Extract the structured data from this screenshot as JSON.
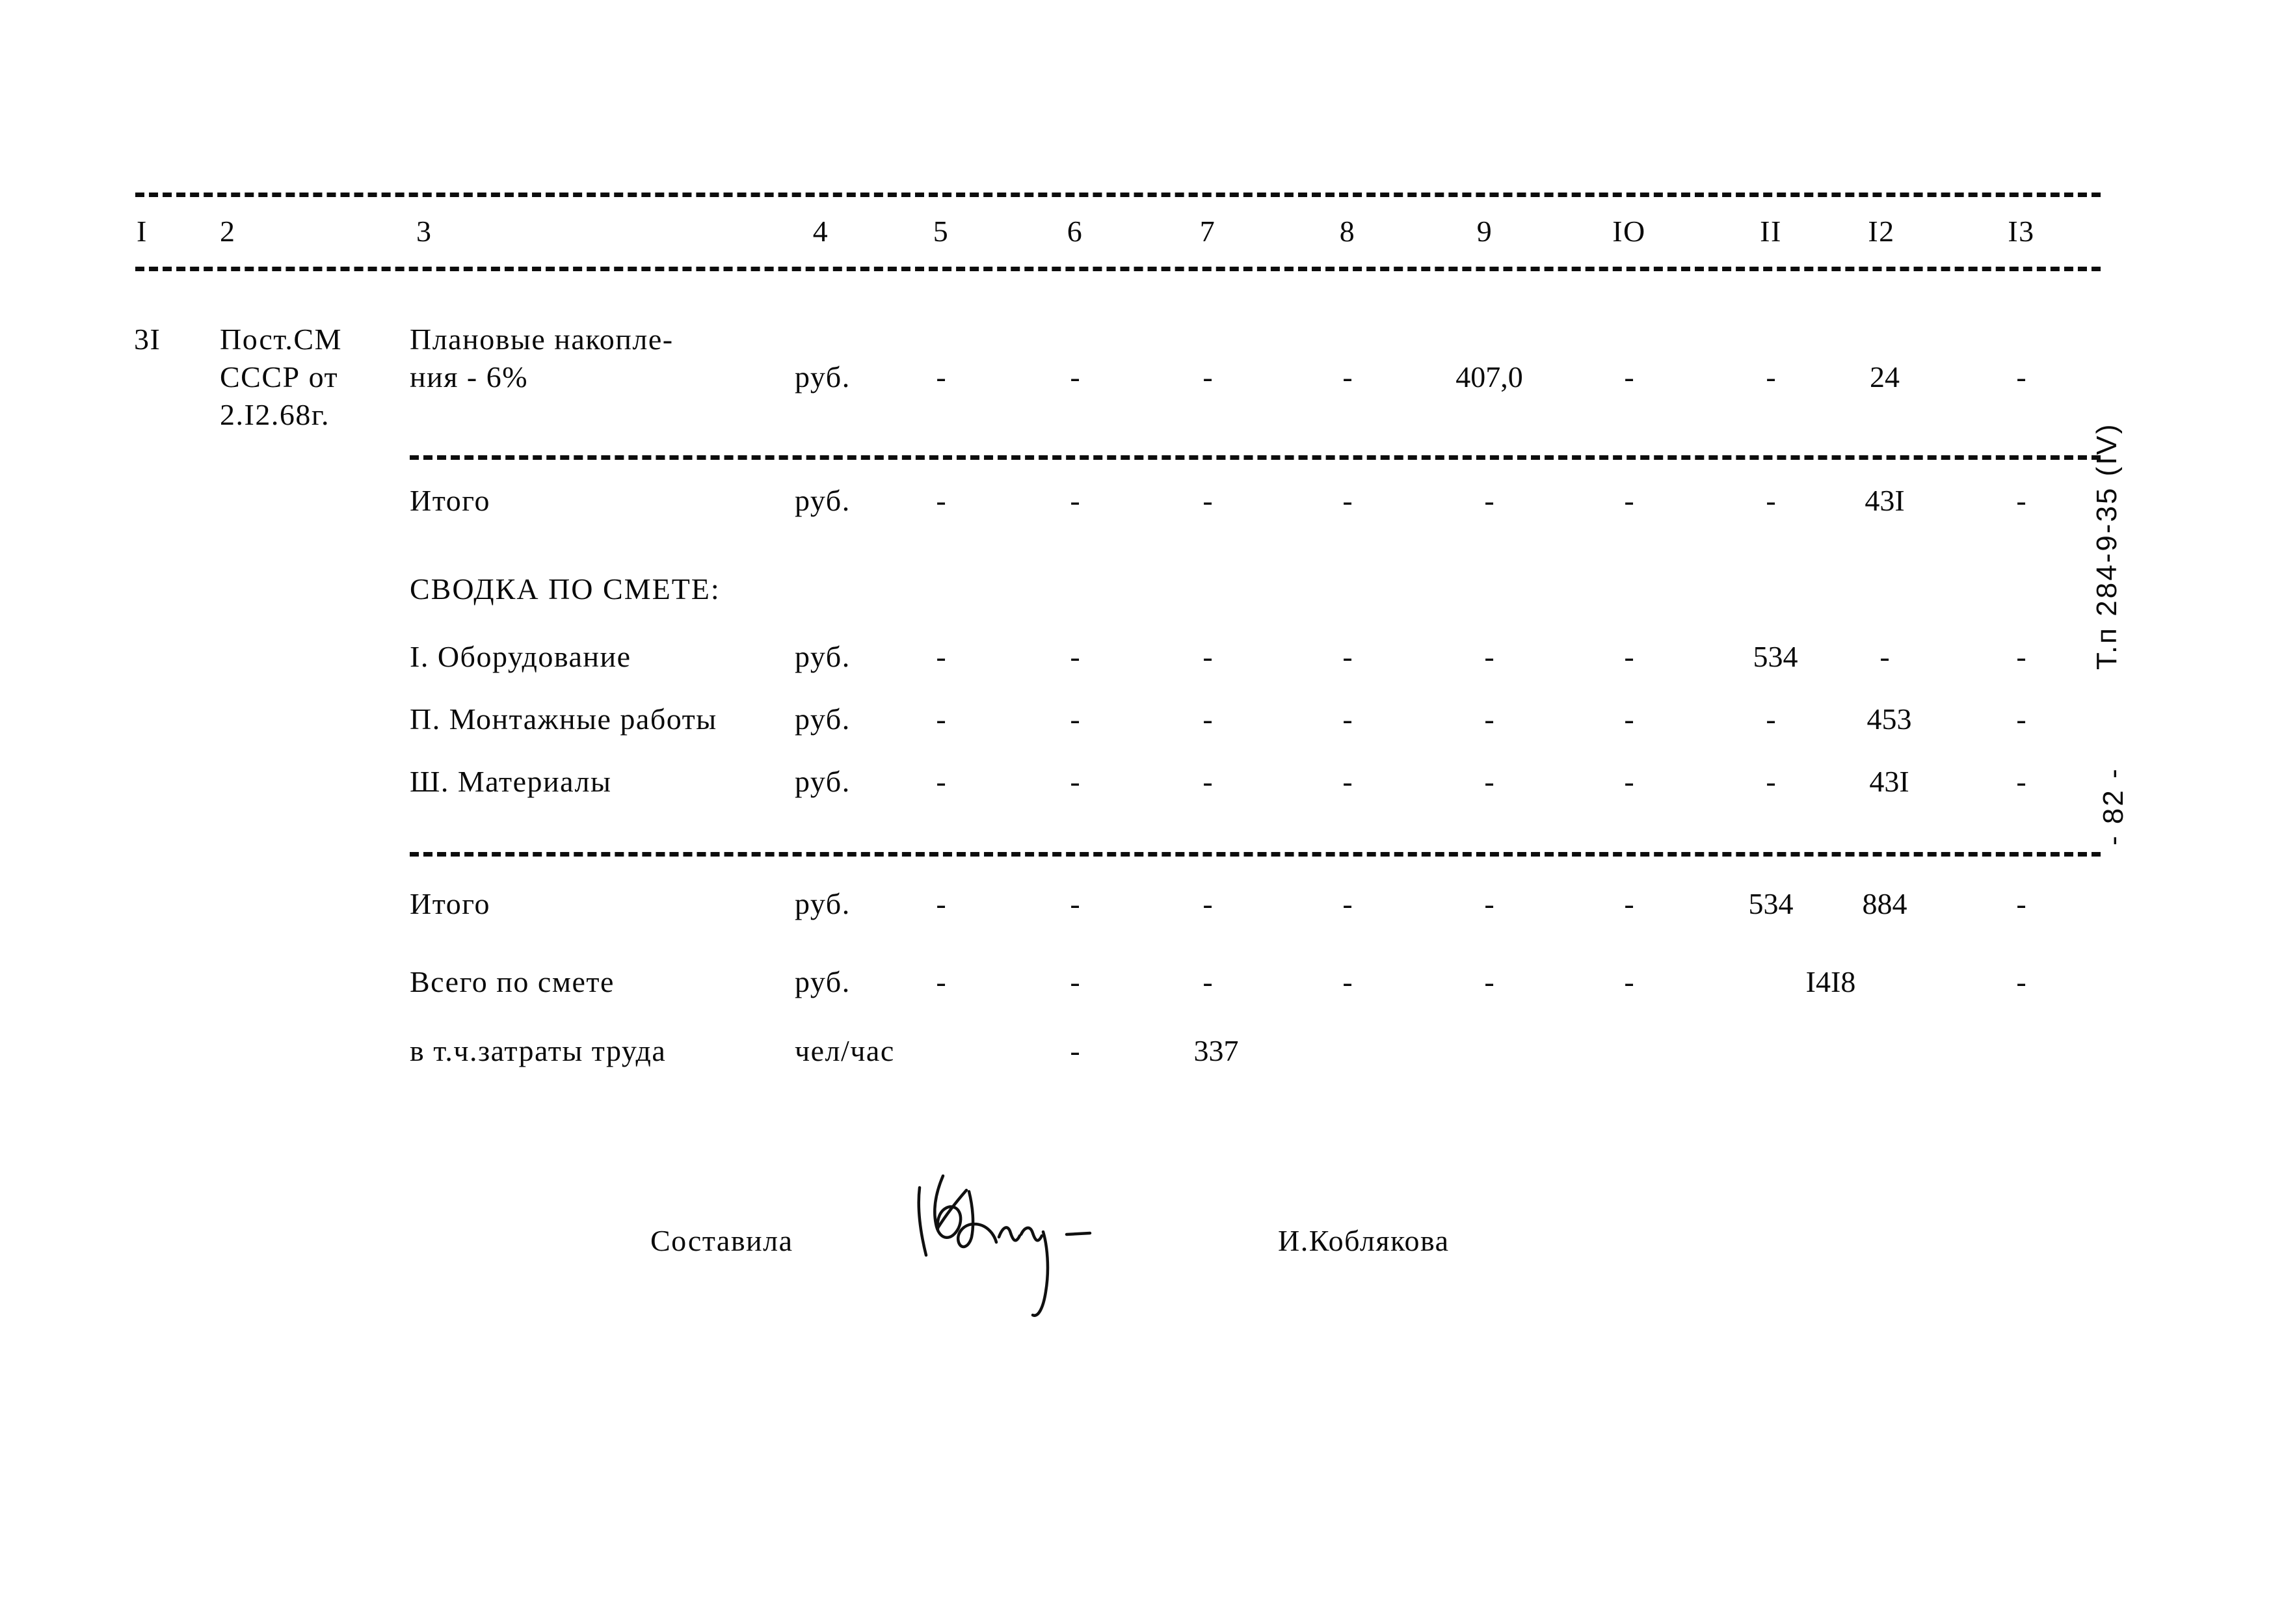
{
  "document": {
    "type": "Soviet construction cost estimate sheet (smeta)",
    "margin_note": "Т.п 284-9-35 (IV)",
    "page_number": "- 82 -"
  },
  "table": {
    "column_headers": [
      "I",
      "2",
      "3",
      "4",
      "5",
      "6",
      "7",
      "8",
      "9",
      "IO",
      "II",
      "I2",
      "I3"
    ],
    "rows": [
      {
        "num": "3I",
        "basis_lines": [
          "Пост.СМ",
          "СССР от",
          "2.I2.68г."
        ],
        "description_lines": [
          "Плановые накопле-",
          "ния - 6%"
        ],
        "unit": "руб.",
        "c5": "-",
        "c6": "-",
        "c7": "-",
        "c8": "-",
        "c9": "407,0",
        "c10": "-",
        "c11": "-",
        "c12": "24",
        "c13": "-"
      },
      {
        "label": "Итого",
        "unit": "руб.",
        "c5": "-",
        "c6": "-",
        "c7": "-",
        "c8": "-",
        "c9": "-",
        "c10": "-",
        "c11": "-",
        "c12": "43I",
        "c13": "-"
      }
    ],
    "summary_heading": "СВОДКА ПО СМЕТЕ:",
    "summary_rows": [
      {
        "label": "I. Оборудование",
        "unit": "руб.",
        "c5": "-",
        "c6": "-",
        "c7": "-",
        "c8": "-",
        "c9": "-",
        "c10": "-",
        "c11": "534",
        "c12": "-",
        "c13": "-"
      },
      {
        "label": "П. Монтажные работы",
        "unit": "руб.",
        "c5": "-",
        "c6": "-",
        "c7": "-",
        "c8": "-",
        "c9": "-",
        "c10": "-",
        "c11": "-",
        "c12": "453",
        "c13": "-"
      },
      {
        "label": "Ш. Материалы",
        "unit": "руб.",
        "c5": "-",
        "c6": "-",
        "c7": "-",
        "c8": "-",
        "c9": "-",
        "c10": "-",
        "c11": "-",
        "c12": "43I",
        "c13": "-"
      }
    ],
    "total_rows": [
      {
        "label": "Итого",
        "unit": "руб.",
        "c5": "-",
        "c6": "-",
        "c7": "-",
        "c8": "-",
        "c9": "-",
        "c10": "-",
        "c11": "534",
        "c12": "884",
        "c13": "-"
      },
      {
        "label": "Всего по смете",
        "unit": "руб.",
        "c5": "-",
        "c6": "-",
        "c7": "-",
        "c8": "-",
        "c9": "-",
        "c10": "-",
        "c11_12": "I4I8",
        "c13": "-"
      },
      {
        "label": "в т.ч.затраты труда",
        "unit": "чел/час",
        "c6": "-",
        "c7": "337"
      }
    ]
  },
  "signature_block": {
    "role": "Составила",
    "name": "И.Коблякова"
  }
}
